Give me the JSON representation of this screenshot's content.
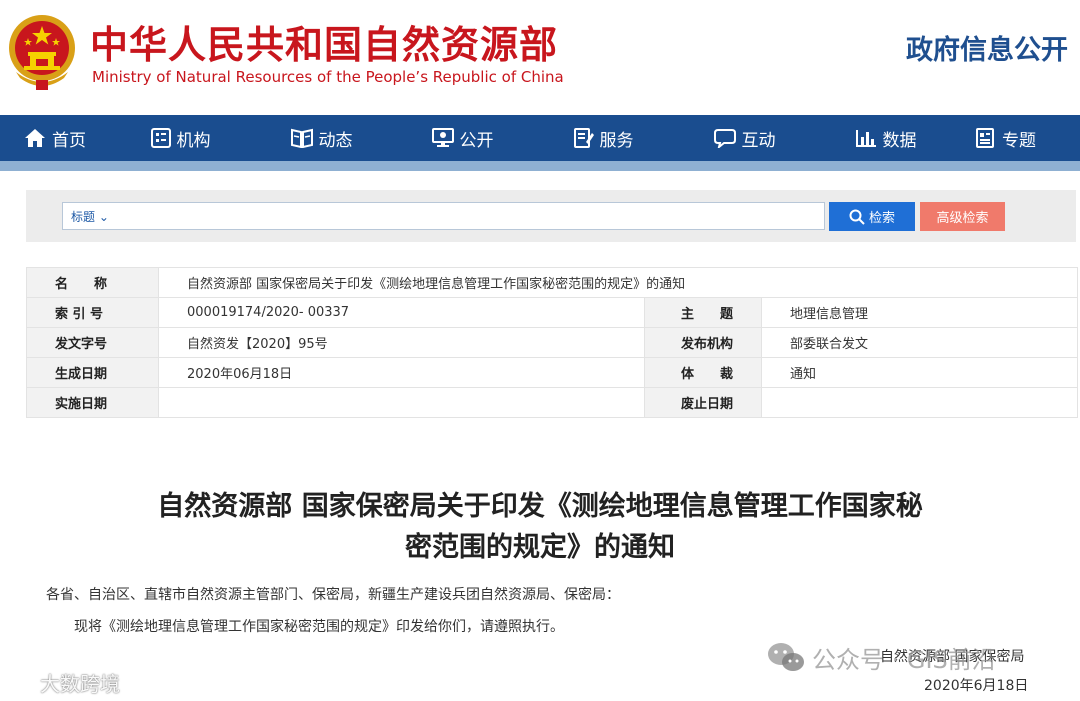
{
  "header": {
    "title": "中华人民共和国自然资源部",
    "subtitle": "Ministry of Natural Resources of the People’s Republic of China",
    "right_link": "政府信息公开"
  },
  "nav": {
    "items": [
      {
        "label": "首页",
        "icon": "home-icon"
      },
      {
        "label": "机构",
        "icon": "organization-icon"
      },
      {
        "label": "动态",
        "icon": "book-icon"
      },
      {
        "label": "公开",
        "icon": "monitor-icon"
      },
      {
        "label": "服务",
        "icon": "document-edit-icon"
      },
      {
        "label": "互动",
        "icon": "chat-icon"
      },
      {
        "label": "数据",
        "icon": "bar-chart-icon"
      },
      {
        "label": "专题",
        "icon": "topic-icon"
      }
    ]
  },
  "search": {
    "scope": "标题 ⌄",
    "search_label": "检索",
    "advanced_label": "高级检索"
  },
  "meta": {
    "name_label": "名　　称",
    "name_value": "自然资源部 国家保密局关于印发《测绘地理信息管理工作国家秘密范围的规定》的通知",
    "index_label": "索 引 号",
    "index_value": "000019174/2020- 00337",
    "topic_label": "主　　题",
    "topic_value": "地理信息管理",
    "docno_label": "发文字号",
    "docno_value": "自然资发【2020】95号",
    "issuer_label": "发布机构",
    "issuer_value": "部委联合发文",
    "gen_label": "生成日期",
    "gen_value": "2020年06月18日",
    "genre_label": "体　　裁",
    "genre_value": "通知",
    "impl_label": "实施日期",
    "impl_value": "",
    "abol_label": "废止日期",
    "abol_value": ""
  },
  "article": {
    "title": "自然资源部 国家保密局关于印发《测绘地理信息管理工作国家秘密范围的规定》的通知",
    "para1": "各省、自治区、直辖市自然资源主管部门、保密局，新疆生产建设兵团自然资源局、保密局：",
    "para2": "现将《测绘地理信息管理工作国家秘密范围的规定》印发给你们，请遵照执行。",
    "sign_org": "自然资源部  国家保密局",
    "sign_date": "2020年6月18日"
  },
  "watermarks": {
    "left": "大数跨境",
    "right": "公众号 · GIS前沿"
  },
  "colors": {
    "brand_red": "#c8161d",
    "nav_blue": "#1a4d8f",
    "search_blue": "#1f6fd6",
    "advanced_red": "#f07a6b"
  }
}
